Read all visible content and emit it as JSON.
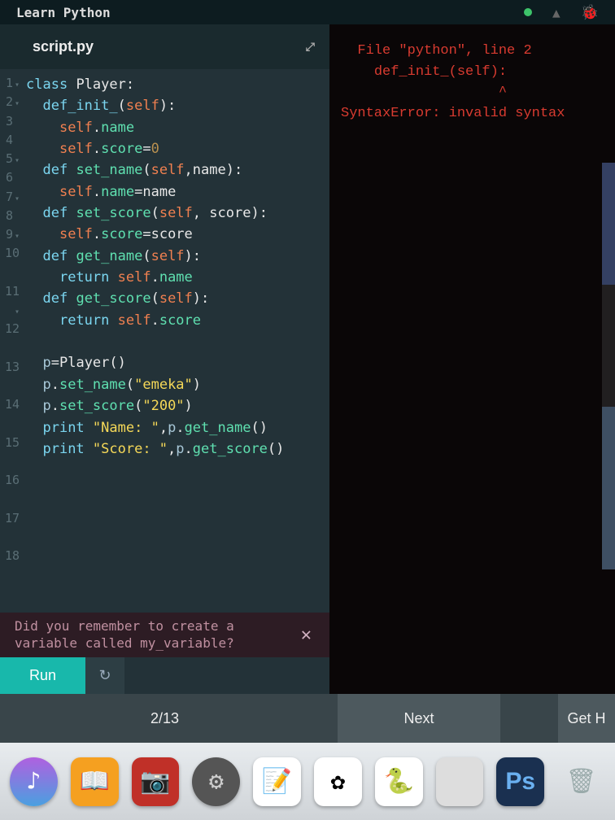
{
  "header": {
    "title": "Learn Python"
  },
  "editor": {
    "tab_title": "script.py",
    "lines": [
      {
        "n": 1,
        "fold": true,
        "tokens": [
          [
            "kw",
            "class"
          ],
          [
            "sp",
            " "
          ],
          [
            "cls",
            "Player"
          ],
          [
            "punc",
            ":"
          ]
        ]
      },
      {
        "n": 2,
        "fold": true,
        "tokens": [
          [
            "ind",
            "  "
          ],
          [
            "init",
            "def_init_"
          ],
          [
            "punc",
            "("
          ],
          [
            "self",
            "self"
          ],
          [
            "punc",
            "):"
          ]
        ]
      },
      {
        "n": 3,
        "fold": false,
        "tokens": [
          [
            "ind",
            "    "
          ],
          [
            "self",
            "self"
          ],
          [
            "punc",
            "."
          ],
          [
            "attr",
            "name"
          ]
        ]
      },
      {
        "n": 4,
        "fold": false,
        "tokens": [
          [
            "ind",
            "    "
          ],
          [
            "self",
            "self"
          ],
          [
            "punc",
            "."
          ],
          [
            "attr",
            "score"
          ],
          [
            "punc",
            "="
          ],
          [
            "num",
            "0"
          ]
        ]
      },
      {
        "n": 5,
        "fold": true,
        "tokens": [
          [
            "ind",
            "  "
          ],
          [
            "kw",
            "def"
          ],
          [
            "sp",
            " "
          ],
          [
            "func",
            "set_name"
          ],
          [
            "punc",
            "("
          ],
          [
            "self",
            "self"
          ],
          [
            "punc",
            ","
          ],
          [
            "var",
            "name"
          ],
          [
            "punc",
            "):"
          ]
        ]
      },
      {
        "n": 6,
        "fold": false,
        "tokens": [
          [
            "ind",
            "    "
          ],
          [
            "self",
            "self"
          ],
          [
            "punc",
            "."
          ],
          [
            "attr",
            "name"
          ],
          [
            "punc",
            "="
          ],
          [
            "var",
            "name"
          ]
        ]
      },
      {
        "n": 7,
        "fold": true,
        "tokens": [
          [
            "ind",
            "  "
          ],
          [
            "kw",
            "def"
          ],
          [
            "sp",
            " "
          ],
          [
            "func",
            "set_score"
          ],
          [
            "punc",
            "("
          ],
          [
            "self",
            "self"
          ],
          [
            "punc",
            ", "
          ],
          [
            "var",
            "score"
          ],
          [
            "punc",
            "):"
          ]
        ]
      },
      {
        "n": 8,
        "fold": false,
        "tokens": [
          [
            "ind",
            "    "
          ],
          [
            "self",
            "self"
          ],
          [
            "punc",
            "."
          ],
          [
            "attr",
            "score"
          ],
          [
            "punc",
            "="
          ],
          [
            "var",
            "score"
          ]
        ]
      },
      {
        "n": 9,
        "fold": true,
        "tokens": [
          [
            "ind",
            "  "
          ],
          [
            "kw",
            "def"
          ],
          [
            "sp",
            " "
          ],
          [
            "func",
            "get_name"
          ],
          [
            "punc",
            "("
          ],
          [
            "self",
            "self"
          ],
          [
            "punc",
            "):"
          ]
        ]
      },
      {
        "n": 10,
        "fold": false,
        "tokens": [
          [
            "ind",
            "    "
          ],
          [
            "kw",
            "return"
          ],
          [
            "sp",
            " "
          ],
          [
            "self",
            "self"
          ],
          [
            "punc",
            "."
          ],
          [
            "attr",
            "name"
          ]
        ]
      },
      {
        "n": 11,
        "fold": true,
        "tokens": [
          [
            "ind",
            "  "
          ],
          [
            "kw",
            "def"
          ],
          [
            "sp",
            " "
          ],
          [
            "func",
            "get_score"
          ],
          [
            "punc",
            "("
          ],
          [
            "self",
            "self"
          ],
          [
            "punc",
            "):"
          ]
        ]
      },
      {
        "n": 12,
        "fold": false,
        "tokens": [
          [
            "ind",
            "    "
          ],
          [
            "kw",
            "return"
          ],
          [
            "sp",
            " "
          ],
          [
            "self",
            "self"
          ],
          [
            "punc",
            "."
          ],
          [
            "attr",
            "score"
          ]
        ]
      },
      {
        "n": 13,
        "fold": false,
        "tokens": []
      },
      {
        "n": 14,
        "fold": false,
        "tokens": [
          [
            "ind",
            "  "
          ],
          [
            "p",
            "p"
          ],
          [
            "punc",
            "="
          ],
          [
            "cls",
            "Player"
          ],
          [
            "punc",
            "()"
          ]
        ]
      },
      {
        "n": 15,
        "fold": false,
        "tokens": [
          [
            "ind",
            "  "
          ],
          [
            "p",
            "p"
          ],
          [
            "punc",
            "."
          ],
          [
            "func",
            "set_name"
          ],
          [
            "punc",
            "("
          ],
          [
            "str",
            "\"emeka\""
          ],
          [
            "punc",
            ")"
          ]
        ]
      },
      {
        "n": 16,
        "fold": false,
        "tokens": [
          [
            "ind",
            "  "
          ],
          [
            "p",
            "p"
          ],
          [
            "punc",
            "."
          ],
          [
            "func",
            "set_score"
          ],
          [
            "punc",
            "("
          ],
          [
            "str",
            "\"200\""
          ],
          [
            "punc",
            ")"
          ]
        ]
      },
      {
        "n": 17,
        "fold": false,
        "tokens": [
          [
            "ind",
            "  "
          ],
          [
            "kw",
            "print"
          ],
          [
            "sp",
            " "
          ],
          [
            "str",
            "\"Name: \""
          ],
          [
            "punc",
            ","
          ],
          [
            "p",
            "p"
          ],
          [
            "punc",
            "."
          ],
          [
            "func",
            "get_name"
          ],
          [
            "punc",
            "()"
          ]
        ]
      },
      {
        "n": 18,
        "fold": false,
        "tokens": [
          [
            "ind",
            "  "
          ],
          [
            "kw",
            "print"
          ],
          [
            "sp",
            " "
          ],
          [
            "str",
            "\"Score: \""
          ],
          [
            "punc",
            ","
          ],
          [
            "p",
            "p"
          ],
          [
            "punc",
            "."
          ],
          [
            "func",
            "get_score"
          ],
          [
            "punc",
            "()"
          ]
        ]
      }
    ]
  },
  "console": {
    "line1": "  File \"python\", line 2",
    "line2": "    def_init_(self):",
    "caret": "                   ^",
    "line3": "SyntaxError: invalid syntax"
  },
  "hint": {
    "text": "Did you remember to create a variable called my_variable?",
    "close": "✕"
  },
  "controls": {
    "run": "Run",
    "reset": "↻"
  },
  "nav": {
    "page": "2/13",
    "next": "Next",
    "help": "Get H"
  },
  "dock": {
    "apps": [
      "itunes",
      "ibooks",
      "photobooth",
      "settings",
      "notes",
      "photos",
      "python",
      "blank",
      "ps",
      "trash"
    ]
  }
}
